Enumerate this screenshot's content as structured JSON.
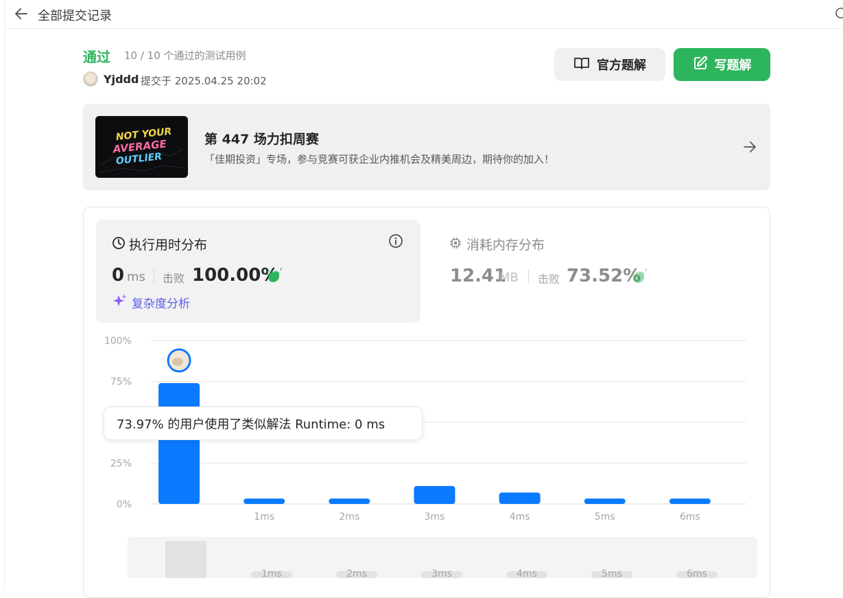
{
  "header": {
    "title": "全部提交记录",
    "back_icon": "arrow-left-icon",
    "right_icon": "link-icon"
  },
  "submission": {
    "status": "通过",
    "testcases": "10 / 10 个通过的测试用例",
    "username": "Yjddd",
    "submitted_at": "提交于 2025.04.25 20:02"
  },
  "actions": {
    "official_solution_label": "官方题解",
    "official_solution_icon": "open-book-icon",
    "write_solution_label": "写题解",
    "write_solution_icon": "edit-icon"
  },
  "banner": {
    "title": "第 447 场力扣周赛",
    "subtitle": "「佳期投资」专场，参与竞赛可获企业内推机会及精美周边，期待你的加入！",
    "image_lines": [
      "NOT YOUR",
      "AVERAGE",
      "OUTLIER"
    ],
    "arrow_icon": "arrow-right-icon"
  },
  "runtime": {
    "title": "执行用时分布",
    "value": "0",
    "unit": "ms",
    "beat_label": "击败",
    "beat_percent": "100.00%",
    "complexity_label": "复杂度分析"
  },
  "memory": {
    "title": "消耗内存分布",
    "value": "12.41",
    "unit": "MB",
    "beat_label": "击败",
    "beat_percent": "73.52%"
  },
  "tooltip": {
    "text": "73.97% 的用户使用了类似解法 Runtime: 0 ms"
  },
  "colors": {
    "accepted": "#2db55d",
    "bar": "#0a7aff",
    "complexity": "#5b5ee8"
  },
  "chart_data": {
    "type": "bar",
    "categories": [
      "",
      "1ms",
      "2ms",
      "3ms",
      "4ms",
      "5ms",
      "6ms"
    ],
    "values": [
      73.97,
      3.3,
      3.3,
      11,
      7,
      3.3,
      3.3
    ],
    "y_tick_labels": [
      "100%",
      "75%",
      "25%",
      "0%"
    ],
    "y_ticks": [
      100,
      75,
      50,
      25,
      0
    ],
    "ylim": [
      0,
      100
    ],
    "grid": true,
    "highlight_index": 0,
    "overview_labels": [
      "1ms",
      "2ms",
      "3ms",
      "4ms",
      "5ms",
      "6ms"
    ]
  }
}
